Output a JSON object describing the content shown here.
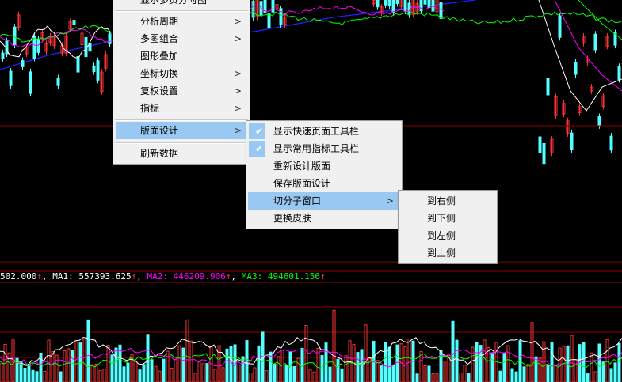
{
  "colors": {
    "background": "#000000",
    "up_candle": "#ff3232",
    "down_candle": "#54ffff",
    "ma1": "#ffffff",
    "ma2": "#ff00ff",
    "ma3": "#00ff00",
    "trend_line": "#2020ff",
    "divider": "#8b0000",
    "menu_bg": "#f0f0f0",
    "menu_highlight": "#99c9f3"
  },
  "indicator_bar": {
    "vol": "502.000",
    "vol_arrow": "↑",
    "ma1_label": "MA1:",
    "ma1_value": "557393.625",
    "ma1_arrow": "↑",
    "ma2_label": "MA2:",
    "ma2_value": "446209.906",
    "ma2_arrow": "↑",
    "ma3_label": "MA3:",
    "ma3_value": "494601.156",
    "ma3_arrow": "↑"
  },
  "context_menu": {
    "partial_top_item": "显示多页分时图",
    "items": [
      {
        "label": "分析周期",
        "arrow": ">"
      },
      {
        "label": "多图组合",
        "arrow": ">"
      },
      {
        "label": "图形叠加",
        "arrow": ""
      },
      {
        "label": "坐标切换",
        "arrow": ">"
      },
      {
        "label": "复权设置",
        "arrow": ">"
      },
      {
        "label": "指标",
        "arrow": ">"
      },
      {
        "label": "版面设计",
        "arrow": ">"
      },
      {
        "label": "刷新数据",
        "arrow": ""
      }
    ]
  },
  "layout_submenu": {
    "items": [
      {
        "label": "显示快速页面工具栏",
        "checked": true,
        "check": "✔"
      },
      {
        "label": "显示常用指标工具栏",
        "checked": true,
        "check": "✔"
      },
      {
        "label": "重新设计版面",
        "checked": false,
        "check": ""
      },
      {
        "label": "保存版面设计",
        "checked": false,
        "check": ""
      },
      {
        "label": "切分子窗口",
        "checked": false,
        "check": "",
        "arrow": ">"
      },
      {
        "label": "更换皮肤",
        "checked": false,
        "check": ""
      }
    ]
  },
  "split_submenu": {
    "items": [
      {
        "label": "到右侧"
      },
      {
        "label": "到下侧"
      },
      {
        "label": "到左侧"
      },
      {
        "label": "到上侧"
      }
    ]
  }
}
